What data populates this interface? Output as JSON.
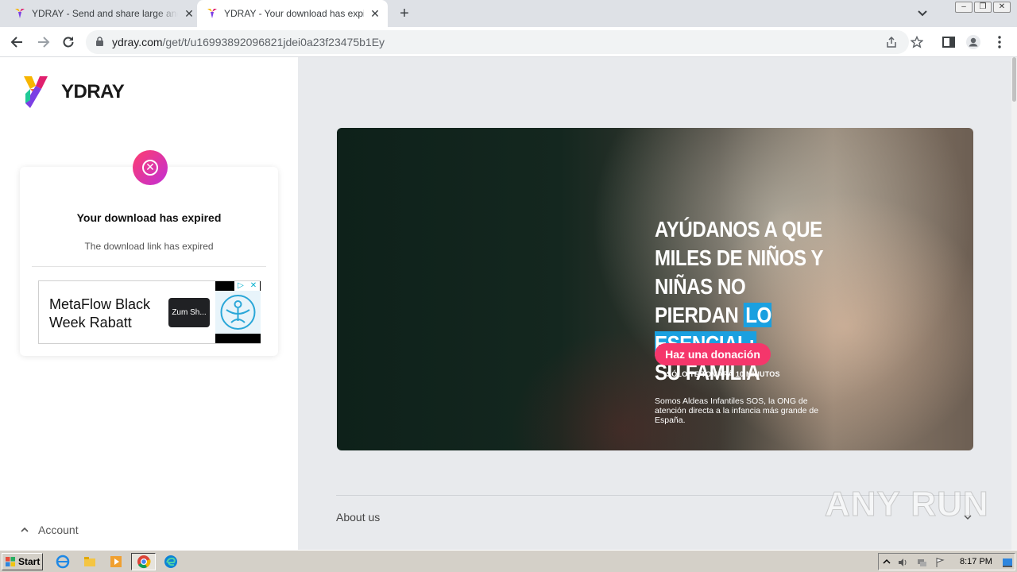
{
  "browser": {
    "tabs": [
      {
        "title": "YDRAY - Send and share large and big files",
        "active": false
      },
      {
        "title": "YDRAY - Your download has expired",
        "active": true
      }
    ],
    "new_tab_label": "+",
    "url_host": "ydray.com",
    "url_path": "/get/t/u16993892096821jdei0a23f23475b1Ey"
  },
  "sidebar": {
    "brand": "YDRAY",
    "card": {
      "title": "Your download has expired",
      "subtitle": "The download link has expired"
    },
    "ad": {
      "text": "MetaFlow Black Week Rabatt",
      "button": "Zum Sh..."
    },
    "account_label": "Account"
  },
  "banner": {
    "headline_part1": "AYÚDANOS A QUE MILES DE NIÑOS Y NIÑAS NO PIERDAN",
    "headline_highlight": "LO ESENCIAL:",
    "headline_part2": "SU FAMILIA",
    "donate_label": "Haz una donación",
    "minutes_note": "SÓLO TE TOMARÁ 10 MINUTOS",
    "sos_text": "Somos Aldeas Infantiles SOS, la ONG de atención directa a la infancia más grande de España."
  },
  "footer": {
    "about_label": "About us"
  },
  "watermark": "ANY RUN",
  "taskbar": {
    "start_label": "Start",
    "clock": "8:17 PM"
  },
  "colors": {
    "accent_pink": "#f5366b",
    "highlight_blue": "#1aa0e0",
    "content_bg": "#e8eaed"
  }
}
